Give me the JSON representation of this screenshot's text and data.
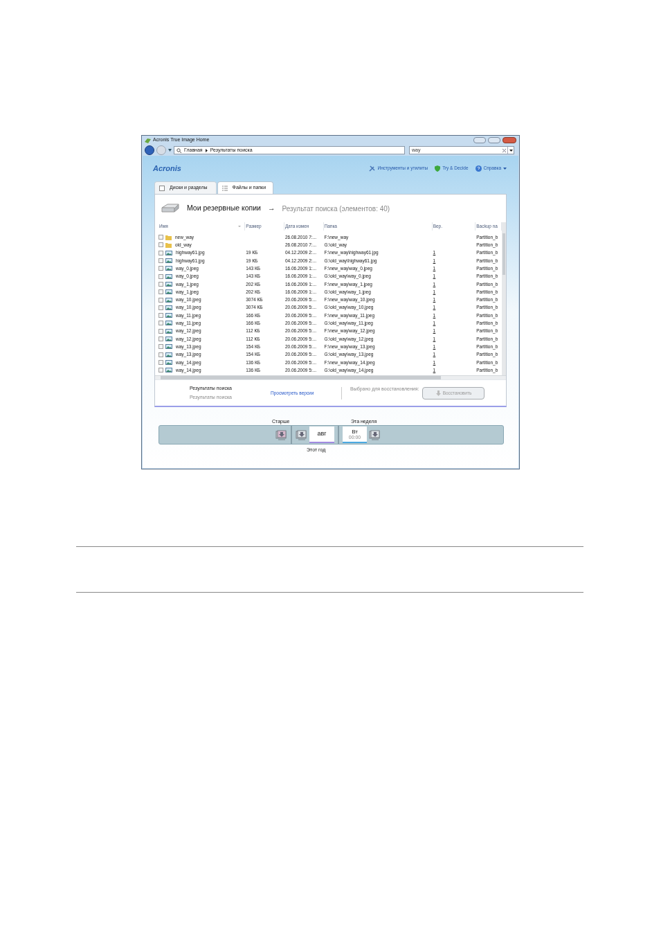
{
  "window": {
    "title": "Acronis True Image Home"
  },
  "address_bar": {
    "crumbs": [
      "Главная",
      "Результаты поиска"
    ]
  },
  "search": {
    "value": "way"
  },
  "brand": {
    "logo": "Acronis"
  },
  "toolbar": [
    {
      "kind": "tools",
      "label": "Инструменты и утилиты"
    },
    {
      "kind": "shield",
      "label": "Try & Decide"
    },
    {
      "kind": "help",
      "label": "Справка"
    }
  ],
  "tabs": [
    {
      "kind": "disk",
      "label": "Диски и разделы",
      "selected": false
    },
    {
      "kind": "list",
      "label": "Файлы и папки",
      "selected": true
    }
  ],
  "heading": {
    "title": "Мои резервные копии",
    "arrow": "→",
    "subtitle": "Результат поиска (элементов: 40)"
  },
  "table": {
    "columns": [
      "Имя",
      "Размер",
      "Дата измен",
      "Папка",
      "Вер.",
      "Backup na"
    ],
    "rows": [
      {
        "kind": "folder",
        "checked": false,
        "name": "new_way",
        "size": "",
        "date": "26.08.2010 7:...",
        "folder": "F:\\new_way",
        "version": "",
        "backup": "Partition_b"
      },
      {
        "kind": "folder",
        "checked": false,
        "name": "old_way",
        "size": "",
        "date": "26.08.2010 7:...",
        "folder": "G:\\old_way",
        "version": "",
        "backup": "Partition_b"
      },
      {
        "kind": "image",
        "checked": false,
        "name": "highway61.jpg",
        "size": "19 КБ",
        "date": "04.12.2009 2:...",
        "folder": "F:\\new_way\\highway61.jpg",
        "version": "1",
        "backup": "Partition_b"
      },
      {
        "kind": "image",
        "checked": false,
        "name": "highway61.jpg",
        "size": "19 КБ",
        "date": "04.12.2009 2:...",
        "folder": "G:\\old_way\\highway61.jpg",
        "version": "1",
        "backup": "Partition_b"
      },
      {
        "kind": "image",
        "checked": false,
        "name": "way_0.jpeg",
        "size": "143 КБ",
        "date": "16.06.2009 1:...",
        "folder": "F:\\new_way\\way_0.jpeg",
        "version": "1",
        "backup": "Partition_b"
      },
      {
        "kind": "image",
        "checked": false,
        "name": "way_0.jpeg",
        "size": "143 КБ",
        "date": "16.06.2009 1:...",
        "folder": "G:\\old_way\\way_0.jpeg",
        "version": "1",
        "backup": "Partition_b"
      },
      {
        "kind": "image",
        "checked": false,
        "name": "way_1.jpeg",
        "size": "202 КБ",
        "date": "16.06.2009 1:...",
        "folder": "F:\\new_way\\way_1.jpeg",
        "version": "1",
        "backup": "Partition_b"
      },
      {
        "kind": "image",
        "checked": false,
        "name": "way_1.jpeg",
        "size": "202 КБ",
        "date": "16.06.2009 1:...",
        "folder": "G:\\old_way\\way_1.jpeg",
        "version": "1",
        "backup": "Partition_b"
      },
      {
        "kind": "image",
        "checked": false,
        "name": "way_10.jpeg",
        "size": "3074 КБ",
        "date": "20.06.2009 5:...",
        "folder": "F:\\new_way\\way_10.jpeg",
        "version": "1",
        "backup": "Partition_b"
      },
      {
        "kind": "image",
        "checked": false,
        "name": "way_10.jpeg",
        "size": "3074 КБ",
        "date": "20.06.2009 5:...",
        "folder": "G:\\old_way\\way_10.jpeg",
        "version": "1",
        "backup": "Partition_b"
      },
      {
        "kind": "image",
        "checked": false,
        "name": "way_11.jpeg",
        "size": "166 КБ",
        "date": "20.06.2009 5:...",
        "folder": "F:\\new_way\\way_11.jpeg",
        "version": "1",
        "backup": "Partition_b"
      },
      {
        "kind": "image",
        "checked": false,
        "name": "way_11.jpeg",
        "size": "166 КБ",
        "date": "20.06.2009 5:...",
        "folder": "G:\\old_way\\way_11.jpeg",
        "version": "1",
        "backup": "Partition_b"
      },
      {
        "kind": "image",
        "checked": false,
        "name": "way_12.jpeg",
        "size": "112 КБ",
        "date": "20.06.2009 5:...",
        "folder": "F:\\new_way\\way_12.jpeg",
        "version": "1",
        "backup": "Partition_b"
      },
      {
        "kind": "image",
        "checked": false,
        "name": "way_12.jpeg",
        "size": "112 КБ",
        "date": "20.06.2009 5:...",
        "folder": "G:\\old_way\\way_12.jpeg",
        "version": "1",
        "backup": "Partition_b"
      },
      {
        "kind": "image",
        "checked": false,
        "name": "way_13.jpeg",
        "size": "154 КБ",
        "date": "20.06.2009 5:...",
        "folder": "F:\\new_way\\way_13.jpeg",
        "version": "1",
        "backup": "Partition_b"
      },
      {
        "kind": "image",
        "checked": false,
        "name": "way_13.jpeg",
        "size": "154 КБ",
        "date": "20.06.2009 5:...",
        "folder": "G:\\old_way\\way_13.jpeg",
        "version": "1",
        "backup": "Partition_b"
      },
      {
        "kind": "image",
        "checked": false,
        "name": "way_14.jpeg",
        "size": "136 КБ",
        "date": "20.06.2009 5:...",
        "folder": "F:\\new_way\\way_14.jpeg",
        "version": "1",
        "backup": "Partition_b"
      },
      {
        "kind": "image",
        "checked": false,
        "name": "way_14.jpeg",
        "size": "136 КБ",
        "date": "20.06.2009 5:...",
        "folder": "G:\\old_way\\way_14.jpeg",
        "version": "1",
        "backup": "Partition_b"
      }
    ]
  },
  "footer": {
    "title": "Результаты поиска",
    "subtitle": "Результаты поиска",
    "link": "Просмотреть версии",
    "selected_label": "Выбрано для восстановления:",
    "restore_button": {
      "label": "Восстановить",
      "disabled": true
    }
  },
  "timeline": {
    "older": "Старше",
    "this_week": "Эта неделя",
    "this_year": "Этот год",
    "month": "авг",
    "day": "Вт",
    "time": "00:00"
  }
}
